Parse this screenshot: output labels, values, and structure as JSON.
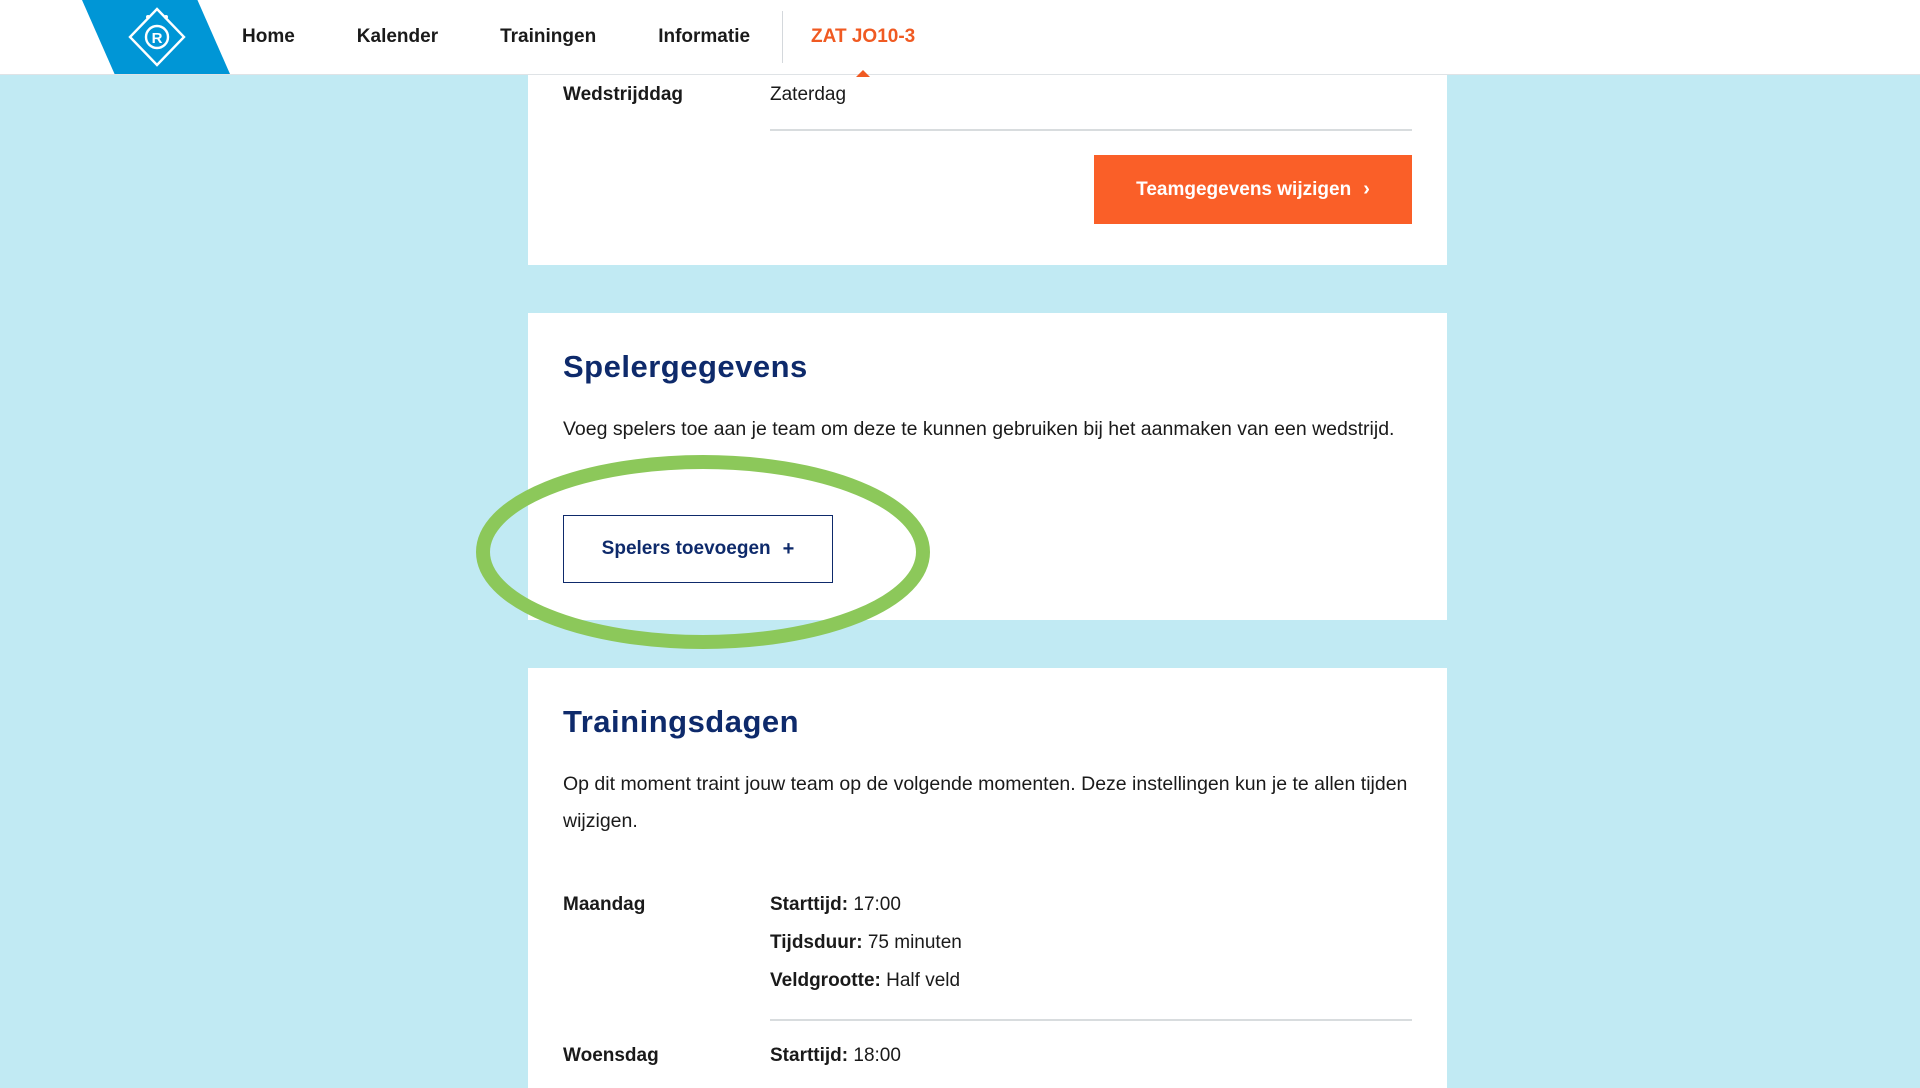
{
  "nav": {
    "logo_icon": "club-logo-icon",
    "items": [
      {
        "label": "Home"
      },
      {
        "label": "Kalender"
      },
      {
        "label": "Trainingen"
      },
      {
        "label": "Informatie"
      }
    ],
    "active_team": "ZAT JO10-3"
  },
  "team_card": {
    "match_day_label": "Wedstrijddag",
    "match_day_value": "Zaterdag",
    "edit_button": "Teamgegevens wijzigen",
    "edit_button_icon": "chevron-right-icon"
  },
  "players_card": {
    "title": "Spelergegevens",
    "description": "Voeg spelers toe aan je team om deze te kunnen gebruiken bij het aanmaken van een wedstrijd.",
    "add_button": "Spelers toevoegen",
    "add_button_icon": "plus-icon"
  },
  "training_card": {
    "title": "Trainingsdagen",
    "description": "Op dit moment traint jouw team op de volgende momenten. Deze instellingen kun je te allen tijden wijzigen.",
    "days": [
      {
        "day": "Maandag",
        "start_label": "Starttijd:",
        "start_value": "17:00",
        "duration_label": "Tijdsduur:",
        "duration_value": "75 minuten",
        "field_label": "Veldgrootte:",
        "field_value": "Half veld"
      },
      {
        "day": "Woensdag",
        "start_label": "Starttijd:",
        "start_value": "18:00"
      }
    ]
  },
  "colors": {
    "background": "#c1eaf3",
    "brand_blue": "#0096d6",
    "accent_orange": "#fa5f28",
    "navy": "#0e2a6b",
    "highlight_green": "#8cc85a"
  }
}
